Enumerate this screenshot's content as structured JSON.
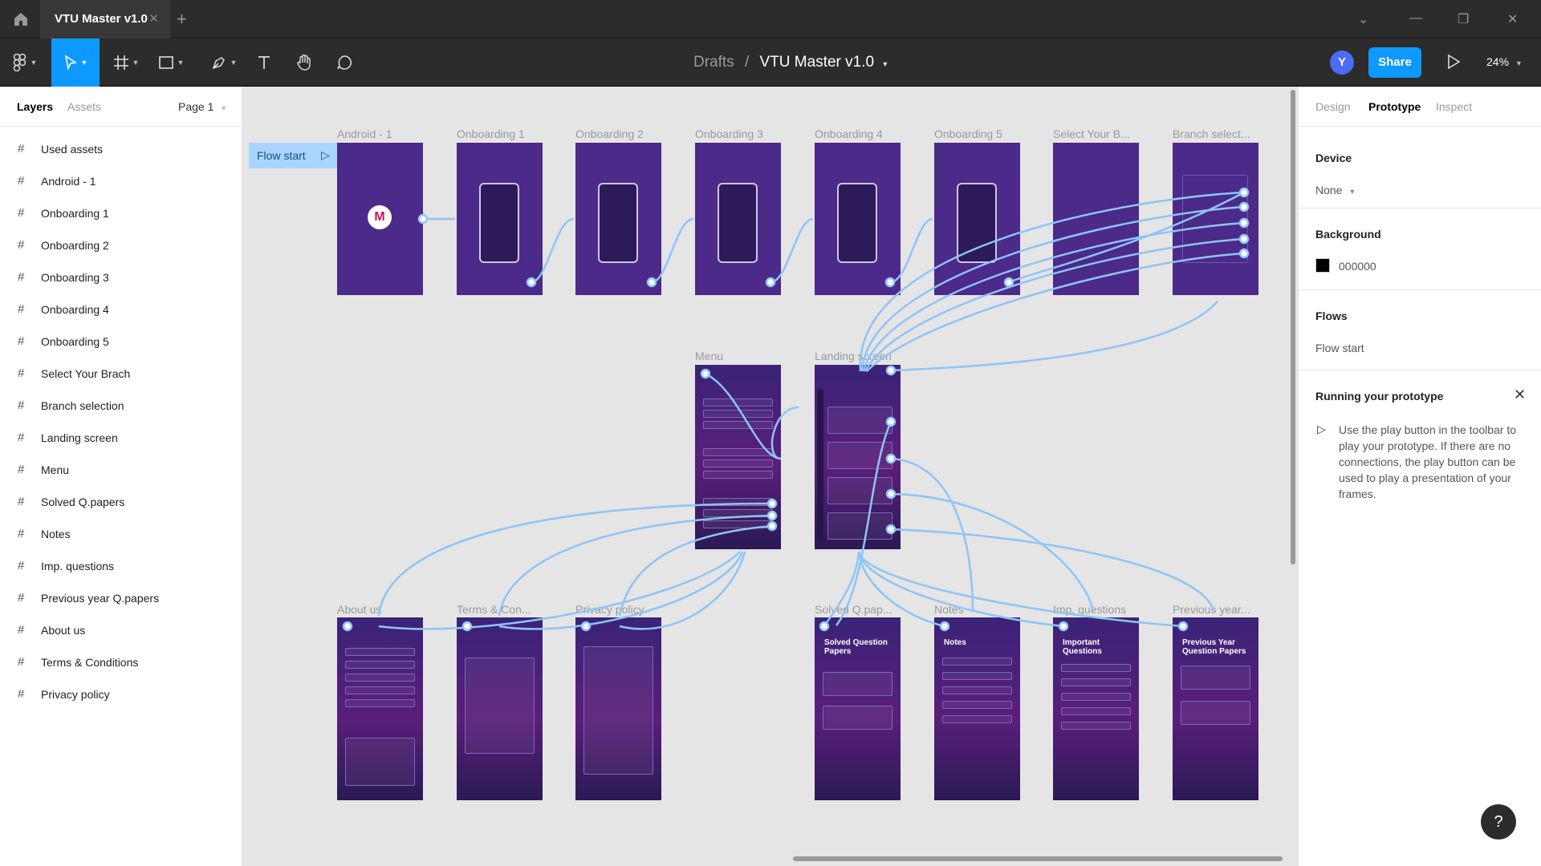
{
  "titlebar": {
    "tab_title": "VTU Master v1.0",
    "close": "✕",
    "new_tab": "+",
    "win_collapse": "⌄",
    "win_min": "—",
    "win_restore": "❐",
    "win_close": "✕"
  },
  "toolbar": {
    "breadcrumb_drafts": "Drafts",
    "breadcrumb_sep": "/",
    "file_name": "VTU Master v1.0",
    "avatar_initial": "Y",
    "share_label": "Share",
    "zoom": "24%",
    "accent": "#0d99ff"
  },
  "left_panel": {
    "tab_layers": "Layers",
    "tab_assets": "Assets",
    "page": "Page 1",
    "layers": [
      "Used assets",
      "Android - 1",
      "Onboarding 1",
      "Onboarding 2",
      "Onboarding 3",
      "Onboarding 4",
      "Onboarding 5",
      "Select Your Brach",
      "Branch selection",
      "Landing screen",
      "Menu",
      "Solved Q.papers",
      "Notes",
      "Imp. questions",
      "Previous year Q.papers",
      "About us",
      "Terms & Conditions",
      "Privacy policy"
    ]
  },
  "canvas": {
    "flow_start": "Flow start",
    "frame_labels": {
      "android": "Android - 1",
      "ob1": "Onboarding 1",
      "ob2": "Onboarding 2",
      "ob3": "Onboarding 3",
      "ob4": "Onboarding 4",
      "ob5": "Onboarding 5",
      "select": "Select Your B...",
      "branch": "Branch select...",
      "menu": "Menu",
      "landing": "Landing screen",
      "about": "About us",
      "terms": "Terms & Con...",
      "privacy": "Privacy policy",
      "solved": "Solved Q.pap...",
      "notes": "Notes",
      "imp": "Imp. questions",
      "prev": "Previous year..."
    },
    "frame_titles": {
      "solved": "Solved Question Papers",
      "notes": "Notes",
      "imp": "Important Questions",
      "prev": "Previous Year Question Papers"
    },
    "frame_color": "#4b2a8a",
    "connector_color": "#8fc4f7"
  },
  "right_panel": {
    "tab_design": "Design",
    "tab_prototype": "Prototype",
    "tab_inspect": "Inspect",
    "device_title": "Device",
    "device_value": "None",
    "background_title": "Background",
    "background_value": "000000",
    "flows_title": "Flows",
    "flow_item": "Flow start",
    "running_title": "Running your prototype",
    "running_text": "Use the play button in the toolbar to play your prototype. If there are no connections, the play button can be used to play a presentation of your frames."
  },
  "help": "?"
}
